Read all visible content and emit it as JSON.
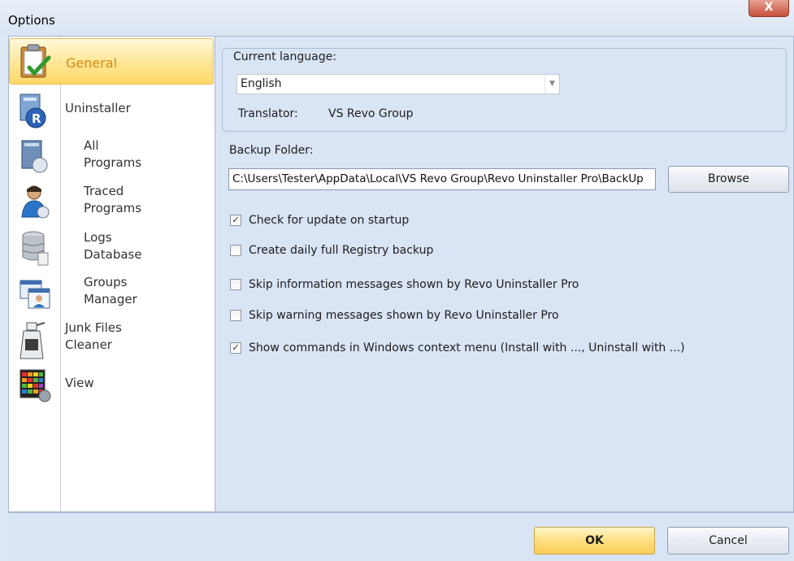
{
  "window": {
    "title": "Options",
    "close_label": "X"
  },
  "sidebar": {
    "items": [
      {
        "label": "General",
        "icon": "clipboard-check-icon",
        "selected": true
      },
      {
        "label": "Uninstaller",
        "icon": "revo-uninstaller-icon"
      },
      {
        "label": "All\nPrograms",
        "icon": "programs-box-icon"
      },
      {
        "label": "Traced\nPrograms",
        "icon": "user-trace-icon"
      },
      {
        "label": "Logs\nDatabase",
        "icon": "database-icon"
      },
      {
        "label": "Groups\nManager",
        "icon": "groups-window-icon"
      },
      {
        "label": "Junk Files\nCleaner",
        "icon": "spray-cleaner-icon"
      },
      {
        "label": "View",
        "icon": "color-grid-icon"
      }
    ]
  },
  "general": {
    "language_group_label": "Current language:",
    "language_value": "English",
    "translator_label": "Translator:",
    "translator_value": "VS Revo Group",
    "backup_label": "Backup Folder:",
    "backup_path": "C:\\Users\\Tester\\AppData\\Local\\VS Revo Group\\Revo Uninstaller Pro\\BackUp",
    "browse_label": "Browse",
    "checkboxes": [
      {
        "label": "Check for update on startup",
        "checked": true
      },
      {
        "label": "Create daily full Registry backup",
        "checked": false
      },
      {
        "label": "Skip information messages shown by Revo Uninstaller Pro",
        "checked": false
      },
      {
        "label": "Skip warning messages shown by Revo Uninstaller Pro",
        "checked": false
      },
      {
        "label": "Show commands in Windows context menu (Install with ..., Uninstall with ...)",
        "checked": true
      }
    ]
  },
  "footer": {
    "ok_label": "OK",
    "cancel_label": "Cancel"
  },
  "colors": {
    "selected_accent": "#ffd766",
    "selected_text": "#d18a12",
    "panel_bg": "#d9e4f4"
  }
}
